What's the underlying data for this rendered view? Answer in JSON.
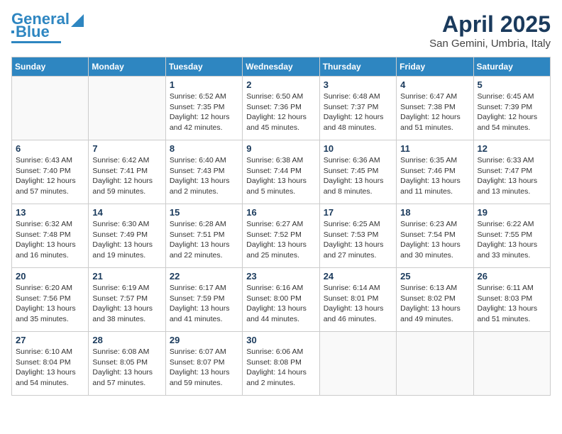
{
  "logo": {
    "line1": "General",
    "line2": "Blue"
  },
  "header": {
    "month_year": "April 2025",
    "location": "San Gemini, Umbria, Italy"
  },
  "weekdays": [
    "Sunday",
    "Monday",
    "Tuesday",
    "Wednesday",
    "Thursday",
    "Friday",
    "Saturday"
  ],
  "weeks": [
    [
      {
        "day": "",
        "info": ""
      },
      {
        "day": "",
        "info": ""
      },
      {
        "day": "1",
        "info": "Sunrise: 6:52 AM\nSunset: 7:35 PM\nDaylight: 12 hours and 42 minutes."
      },
      {
        "day": "2",
        "info": "Sunrise: 6:50 AM\nSunset: 7:36 PM\nDaylight: 12 hours and 45 minutes."
      },
      {
        "day": "3",
        "info": "Sunrise: 6:48 AM\nSunset: 7:37 PM\nDaylight: 12 hours and 48 minutes."
      },
      {
        "day": "4",
        "info": "Sunrise: 6:47 AM\nSunset: 7:38 PM\nDaylight: 12 hours and 51 minutes."
      },
      {
        "day": "5",
        "info": "Sunrise: 6:45 AM\nSunset: 7:39 PM\nDaylight: 12 hours and 54 minutes."
      }
    ],
    [
      {
        "day": "6",
        "info": "Sunrise: 6:43 AM\nSunset: 7:40 PM\nDaylight: 12 hours and 57 minutes."
      },
      {
        "day": "7",
        "info": "Sunrise: 6:42 AM\nSunset: 7:41 PM\nDaylight: 12 hours and 59 minutes."
      },
      {
        "day": "8",
        "info": "Sunrise: 6:40 AM\nSunset: 7:43 PM\nDaylight: 13 hours and 2 minutes."
      },
      {
        "day": "9",
        "info": "Sunrise: 6:38 AM\nSunset: 7:44 PM\nDaylight: 13 hours and 5 minutes."
      },
      {
        "day": "10",
        "info": "Sunrise: 6:36 AM\nSunset: 7:45 PM\nDaylight: 13 hours and 8 minutes."
      },
      {
        "day": "11",
        "info": "Sunrise: 6:35 AM\nSunset: 7:46 PM\nDaylight: 13 hours and 11 minutes."
      },
      {
        "day": "12",
        "info": "Sunrise: 6:33 AM\nSunset: 7:47 PM\nDaylight: 13 hours and 13 minutes."
      }
    ],
    [
      {
        "day": "13",
        "info": "Sunrise: 6:32 AM\nSunset: 7:48 PM\nDaylight: 13 hours and 16 minutes."
      },
      {
        "day": "14",
        "info": "Sunrise: 6:30 AM\nSunset: 7:49 PM\nDaylight: 13 hours and 19 minutes."
      },
      {
        "day": "15",
        "info": "Sunrise: 6:28 AM\nSunset: 7:51 PM\nDaylight: 13 hours and 22 minutes."
      },
      {
        "day": "16",
        "info": "Sunrise: 6:27 AM\nSunset: 7:52 PM\nDaylight: 13 hours and 25 minutes."
      },
      {
        "day": "17",
        "info": "Sunrise: 6:25 AM\nSunset: 7:53 PM\nDaylight: 13 hours and 27 minutes."
      },
      {
        "day": "18",
        "info": "Sunrise: 6:23 AM\nSunset: 7:54 PM\nDaylight: 13 hours and 30 minutes."
      },
      {
        "day": "19",
        "info": "Sunrise: 6:22 AM\nSunset: 7:55 PM\nDaylight: 13 hours and 33 minutes."
      }
    ],
    [
      {
        "day": "20",
        "info": "Sunrise: 6:20 AM\nSunset: 7:56 PM\nDaylight: 13 hours and 35 minutes."
      },
      {
        "day": "21",
        "info": "Sunrise: 6:19 AM\nSunset: 7:57 PM\nDaylight: 13 hours and 38 minutes."
      },
      {
        "day": "22",
        "info": "Sunrise: 6:17 AM\nSunset: 7:59 PM\nDaylight: 13 hours and 41 minutes."
      },
      {
        "day": "23",
        "info": "Sunrise: 6:16 AM\nSunset: 8:00 PM\nDaylight: 13 hours and 44 minutes."
      },
      {
        "day": "24",
        "info": "Sunrise: 6:14 AM\nSunset: 8:01 PM\nDaylight: 13 hours and 46 minutes."
      },
      {
        "day": "25",
        "info": "Sunrise: 6:13 AM\nSunset: 8:02 PM\nDaylight: 13 hours and 49 minutes."
      },
      {
        "day": "26",
        "info": "Sunrise: 6:11 AM\nSunset: 8:03 PM\nDaylight: 13 hours and 51 minutes."
      }
    ],
    [
      {
        "day": "27",
        "info": "Sunrise: 6:10 AM\nSunset: 8:04 PM\nDaylight: 13 hours and 54 minutes."
      },
      {
        "day": "28",
        "info": "Sunrise: 6:08 AM\nSunset: 8:05 PM\nDaylight: 13 hours and 57 minutes."
      },
      {
        "day": "29",
        "info": "Sunrise: 6:07 AM\nSunset: 8:07 PM\nDaylight: 13 hours and 59 minutes."
      },
      {
        "day": "30",
        "info": "Sunrise: 6:06 AM\nSunset: 8:08 PM\nDaylight: 14 hours and 2 minutes."
      },
      {
        "day": "",
        "info": ""
      },
      {
        "day": "",
        "info": ""
      },
      {
        "day": "",
        "info": ""
      }
    ]
  ]
}
